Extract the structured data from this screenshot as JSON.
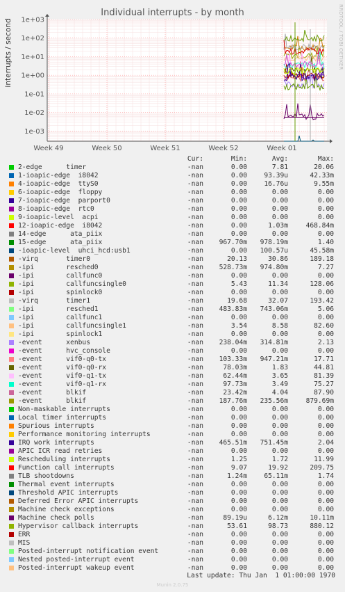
{
  "chart_data": {
    "type": "line",
    "title": "Individual interrupts - by month",
    "ylabel": "interrupts / second",
    "yscale": "log",
    "ylim": [
      0.0003,
      1000
    ],
    "yticks": [
      "1e+03",
      "1e+02",
      "1e+01",
      "1e+00",
      "1e-01",
      "1e-02",
      "1e-03"
    ],
    "ytick_values": [
      1000,
      100,
      10,
      1,
      0.1,
      0.01,
      0.001
    ],
    "xticks": [
      "Week 49",
      "Week 50",
      "Week 51",
      "Week 52",
      "Week 01"
    ],
    "grid": true,
    "background": "#ffffff",
    "grid_color": "#ff9a9a",
    "series_visible_range": "Week 01 onward",
    "series": [
      {
        "name": "15-edge ata_piix",
        "color": "#d4d400",
        "level": 1.0
      },
      {
        "name": "-virq timer0",
        "color": "#cc7700",
        "level": 30.86
      },
      {
        "name": "-ipi resched0",
        "color": "#7700cc",
        "level": 0.97
      },
      {
        "name": "-ipi callfuncsingle0",
        "color": "#9aa800",
        "level": 11.34
      },
      {
        "name": "-virq timer1",
        "color": "#aaaaaa",
        "level": 32.07
      },
      {
        "name": "-ipi resched1",
        "color": "#e06060",
        "level": 0.74
      },
      {
        "name": "-ipi callfuncsingle1",
        "color": "#ffbb88",
        "level": 8.58
      },
      {
        "name": "-event xenbus",
        "color": "#aa88ff",
        "level": 0.31
      },
      {
        "name": "-event vif0-q0-tx",
        "color": "#aa0000",
        "level": 0.95
      },
      {
        "name": "-event vif0-q0-rx",
        "color": "#666600",
        "level": 1.83
      },
      {
        "name": "-event vif0-q1-tx",
        "color": "#ffaaff",
        "level": 3.65
      },
      {
        "name": "-event vif0-q1-rx",
        "color": "#33ffcc",
        "level": 3.49
      },
      {
        "name": "-event blkif",
        "color": "#cc55cc",
        "level": 4.04
      },
      {
        "name": "-event blkif",
        "color": "#669900",
        "level": 0.24
      },
      {
        "name": "IRQ work interrupts",
        "color": "#330099",
        "level": 0.75
      },
      {
        "name": "Rescheduling interrupts",
        "color": "#ccff00",
        "level": 1.72
      },
      {
        "name": "Function call interrupts",
        "color": "#dd0000",
        "level": 19.92
      },
      {
        "name": "Machine check polls",
        "color": "#660066",
        "level": 0.006
      },
      {
        "name": "Hypervisor callback interrupts",
        "color": "#669900",
        "level": 98.73
      },
      {
        "name": "-ioapic-level uhci_hcd:usb1",
        "color": "#005577",
        "level": 0.0001
      }
    ]
  },
  "legend": {
    "headers": {
      "cur": "Cur:",
      "min": "Min:",
      "avg": "Avg:",
      "max": "Max:"
    },
    "rows": [
      {
        "name": "2-edge      timer",
        "color": "#00cc00",
        "cur": "-nan",
        "min": "0.00",
        "avg": "7.81",
        "max": "20.06"
      },
      {
        "name": "1-ioapic-edge  i8042",
        "color": "#0066b3",
        "cur": "-nan",
        "min": "0.00",
        "avg": "93.39u",
        "max": "42.33m"
      },
      {
        "name": "4-ioapic-edge  ttyS0",
        "color": "#ff8000",
        "cur": "-nan",
        "min": "0.00",
        "avg": "16.76u",
        "max": "9.55m"
      },
      {
        "name": "6-ioapic-edge  floppy",
        "color": "#ffcc00",
        "cur": "-nan",
        "min": "0.00",
        "avg": "0.00",
        "max": "0.00"
      },
      {
        "name": "7-ioapic-edge  parport0",
        "color": "#330099",
        "cur": "-nan",
        "min": "0.00",
        "avg": "0.00",
        "max": "0.00"
      },
      {
        "name": "8-ioapic-edge  rtc0",
        "color": "#990099",
        "cur": "-nan",
        "min": "0.00",
        "avg": "0.00",
        "max": "0.00"
      },
      {
        "name": "9-ioapic-level  acpi",
        "color": "#ccff00",
        "cur": "-nan",
        "min": "0.00",
        "avg": "0.00",
        "max": "0.00"
      },
      {
        "name": "12-ioapic-edge  i8042",
        "color": "#ff0000",
        "cur": "-nan",
        "min": "0.00",
        "avg": "1.03m",
        "max": "468.84m"
      },
      {
        "name": "14-edge      ata_piix",
        "color": "#808080",
        "cur": "-nan",
        "min": "0.00",
        "avg": "0.00",
        "max": "0.00"
      },
      {
        "name": "15-edge      ata_piix",
        "color": "#008f00",
        "cur": "-nan",
        "min": "967.70m",
        "avg": "978.19m",
        "max": "1.40"
      },
      {
        "name": "-ioapic-level  uhci_hcd:usb1",
        "color": "#00487d",
        "cur": "-nan",
        "min": "0.00",
        "avg": "100.57u",
        "max": "45.58m"
      },
      {
        "name": "-virq       timer0",
        "color": "#b35a00",
        "cur": "-nan",
        "min": "20.13",
        "avg": "30.86",
        "max": "189.18"
      },
      {
        "name": "-ipi        resched0",
        "color": "#b38f00",
        "cur": "-nan",
        "min": "528.73m",
        "avg": "974.80m",
        "max": "7.27"
      },
      {
        "name": "-ipi        callfunc0",
        "color": "#6b006b",
        "cur": "-nan",
        "min": "0.00",
        "avg": "0.00",
        "max": "0.00"
      },
      {
        "name": "-ipi        callfuncsingle0",
        "color": "#8fb300",
        "cur": "-nan",
        "min": "5.43",
        "avg": "11.34",
        "max": "128.06"
      },
      {
        "name": "-ipi        spinlock0",
        "color": "#b30000",
        "cur": "-nan",
        "min": "0.00",
        "avg": "0.00",
        "max": "0.00"
      },
      {
        "name": "-virq       timer1",
        "color": "#bebebe",
        "cur": "-nan",
        "min": "19.68",
        "avg": "32.07",
        "max": "193.42"
      },
      {
        "name": "-ipi        resched1",
        "color": "#80ff80",
        "cur": "-nan",
        "min": "483.83m",
        "avg": "743.06m",
        "max": "5.06"
      },
      {
        "name": "-ipi        callfunc1",
        "color": "#80c9ff",
        "cur": "-nan",
        "min": "0.00",
        "avg": "0.00",
        "max": "0.00"
      },
      {
        "name": "-ipi        callfuncsingle1",
        "color": "#ffc080",
        "cur": "-nan",
        "min": "3.54",
        "avg": "8.58",
        "max": "82.60"
      },
      {
        "name": "-ipi        spinlock1",
        "color": "#ffe680",
        "cur": "-nan",
        "min": "0.00",
        "avg": "0.00",
        "max": "0.00"
      },
      {
        "name": "-event      xenbus",
        "color": "#aa80ff",
        "cur": "-nan",
        "min": "238.04m",
        "avg": "314.81m",
        "max": "2.13"
      },
      {
        "name": "-event      hvc_console",
        "color": "#ee00cc",
        "cur": "-nan",
        "min": "0.00",
        "avg": "0.00",
        "max": "0.00"
      },
      {
        "name": "-event      vif0-q0-tx",
        "color": "#ff8080",
        "cur": "-nan",
        "min": "103.33m",
        "avg": "947.21m",
        "max": "17.71"
      },
      {
        "name": "-event      vif0-q0-rx",
        "color": "#666600",
        "cur": "-nan",
        "min": "78.03m",
        "avg": "1.83",
        "max": "44.81"
      },
      {
        "name": "-event      vif0-q1-tx",
        "color": "#ffbfff",
        "cur": "-nan",
        "min": "62.44m",
        "avg": "3.65",
        "max": "81.39"
      },
      {
        "name": "-event      vif0-q1-rx",
        "color": "#00ffcc",
        "cur": "-nan",
        "min": "97.73m",
        "avg": "3.49",
        "max": "75.27"
      },
      {
        "name": "-event      blkif",
        "color": "#cc6699",
        "cur": "-nan",
        "min": "23.42m",
        "avg": "4.04",
        "max": "87.90"
      },
      {
        "name": "-event      blkif",
        "color": "#999900",
        "cur": "-nan",
        "min": "187.76m",
        "avg": "235.56m",
        "max": "879.69m"
      },
      {
        "name": "Non-maskable interrupts",
        "color": "#00cc00",
        "cur": "-nan",
        "min": "0.00",
        "avg": "0.00",
        "max": "0.00"
      },
      {
        "name": "Local timer interrupts",
        "color": "#0066b3",
        "cur": "-nan",
        "min": "0.00",
        "avg": "0.00",
        "max": "0.00"
      },
      {
        "name": "Spurious interrupts",
        "color": "#ff8000",
        "cur": "-nan",
        "min": "0.00",
        "avg": "0.00",
        "max": "0.00"
      },
      {
        "name": "Performance monitoring interrupts",
        "color": "#ffcc00",
        "cur": "-nan",
        "min": "0.00",
        "avg": "0.00",
        "max": "0.00"
      },
      {
        "name": "IRQ work interrupts",
        "color": "#330099",
        "cur": "-nan",
        "min": "465.51m",
        "avg": "751.45m",
        "max": "2.04"
      },
      {
        "name": "APIC ICR read retries",
        "color": "#990099",
        "cur": "-nan",
        "min": "0.00",
        "avg": "0.00",
        "max": "0.00"
      },
      {
        "name": "Rescheduling interrupts",
        "color": "#ccff00",
        "cur": "-nan",
        "min": "1.25",
        "avg": "1.72",
        "max": "11.99"
      },
      {
        "name": "Function call interrupts",
        "color": "#ff0000",
        "cur": "-nan",
        "min": "9.07",
        "avg": "19.92",
        "max": "209.75"
      },
      {
        "name": "TLB shootdowns",
        "color": "#808080",
        "cur": "-nan",
        "min": "1.24m",
        "avg": "65.11m",
        "max": "1.74"
      },
      {
        "name": "Thermal event interrupts",
        "color": "#008f00",
        "cur": "-nan",
        "min": "0.00",
        "avg": "0.00",
        "max": "0.00"
      },
      {
        "name": "Threshold APIC interrupts",
        "color": "#00487d",
        "cur": "-nan",
        "min": "0.00",
        "avg": "0.00",
        "max": "0.00"
      },
      {
        "name": "Deferred Error APIC interrupts",
        "color": "#b35a00",
        "cur": "-nan",
        "min": "0.00",
        "avg": "0.00",
        "max": "0.00"
      },
      {
        "name": "Machine check exceptions",
        "color": "#b38f00",
        "cur": "-nan",
        "min": "0.00",
        "avg": "0.00",
        "max": "0.00"
      },
      {
        "name": "Machine check polls",
        "color": "#6b006b",
        "cur": "-nan",
        "min": "89.19u",
        "avg": "6.12m",
        "max": "10.11m"
      },
      {
        "name": "Hypervisor callback interrupts",
        "color": "#8fb300",
        "cur": "-nan",
        "min": "53.61",
        "avg": "98.73",
        "max": "880.12"
      },
      {
        "name": "ERR",
        "color": "#b30000",
        "cur": "-nan",
        "min": "0.00",
        "avg": "0.00",
        "max": "0.00"
      },
      {
        "name": "MIS",
        "color": "#bebebe",
        "cur": "-nan",
        "min": "0.00",
        "avg": "0.00",
        "max": "0.00"
      },
      {
        "name": "Posted-interrupt notification event",
        "color": "#80ff80",
        "cur": "-nan",
        "min": "0.00",
        "avg": "0.00",
        "max": "0.00"
      },
      {
        "name": "Nested posted-interrupt event",
        "color": "#80c9ff",
        "cur": "-nan",
        "min": "0.00",
        "avg": "0.00",
        "max": "0.00"
      },
      {
        "name": "Posted-interrupt wakeup event",
        "color": "#ffc080",
        "cur": "-nan",
        "min": "0.00",
        "avg": "0.00",
        "max": "0.00"
      }
    ]
  },
  "last_update": "Last update: Thu Jan  1 01:00:00 1970",
  "watermark": "RRDTOOL / TOBI OETIKER",
  "footer": "Munin 2.0.75"
}
